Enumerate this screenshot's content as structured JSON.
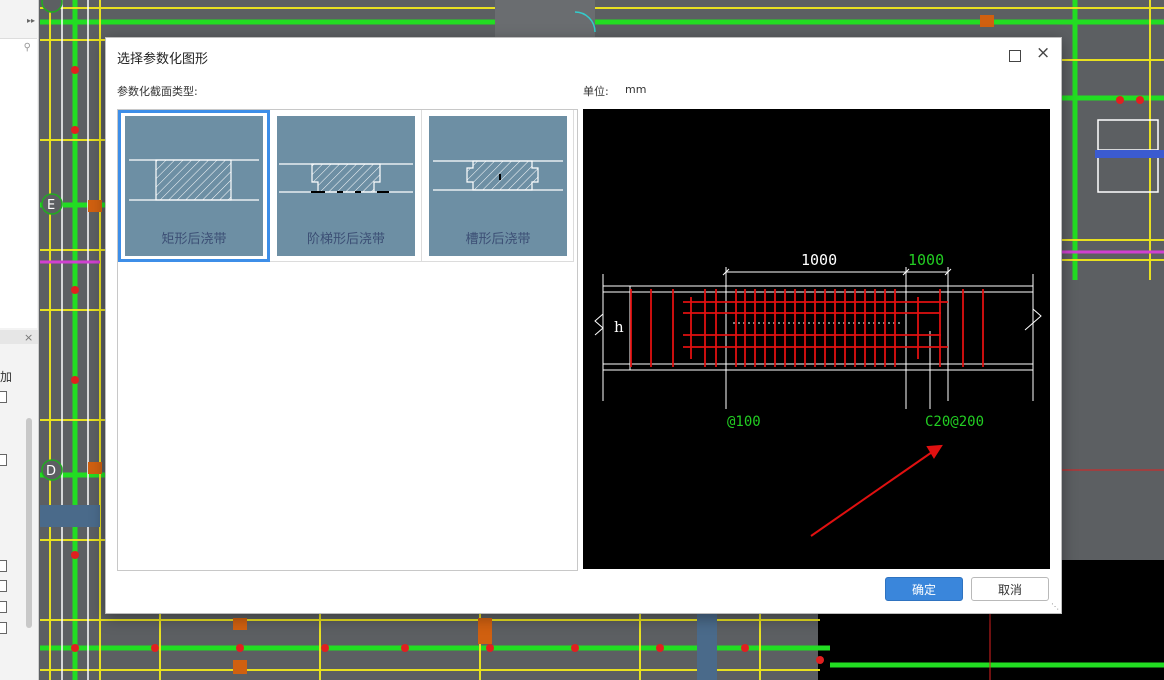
{
  "dialog": {
    "title": "选择参数化图形",
    "section_label": "参数化截面类型:",
    "unit_label": "单位:",
    "unit_value": "mm",
    "ok_label": "确定",
    "cancel_label": "取消"
  },
  "shapes": [
    {
      "label": "矩形后浇带",
      "selected": true
    },
    {
      "label": "阶梯形后浇带",
      "selected": false
    },
    {
      "label": "槽形后浇带",
      "selected": false
    }
  ],
  "preview": {
    "dim_left": "1000",
    "dim_right": "1000",
    "height_label": "h",
    "spacing_label": "@100",
    "rebar_label": "C20@200",
    "colors": {
      "background": "#000000",
      "rebar": "#e01010",
      "dim_text_right": "#22cc22",
      "line": "#ffffff"
    }
  },
  "left_panel": {
    "collapse_glyph": "▸▸",
    "search_icon": "search-icon",
    "close_glyph": "×",
    "partial_label": "加"
  },
  "window_controls": {
    "maximize_icon": "maximize-icon",
    "close_glyph": "×"
  }
}
